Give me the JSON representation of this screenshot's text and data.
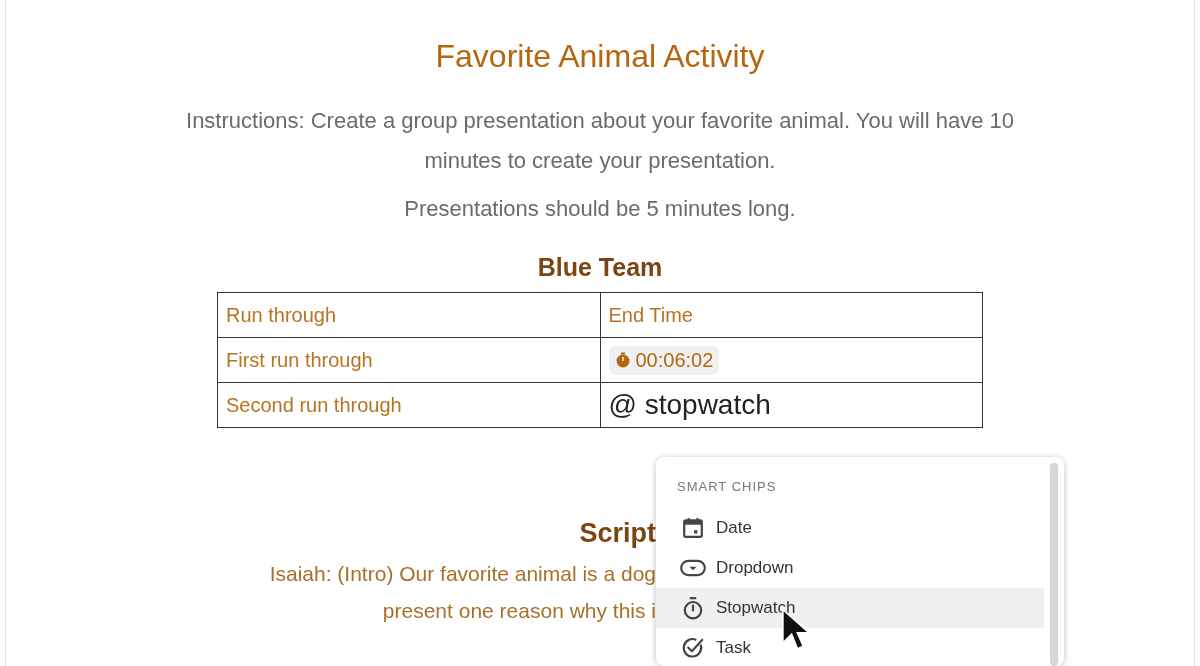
{
  "document": {
    "title": "Favorite Animal Activity",
    "instructions": [
      "Instructions: Create a group presentation about your favorite animal. You will have 10 minutes to create your presentation.",
      "Presentations should be 5 minutes long."
    ],
    "team_heading": "Blue Team",
    "table": {
      "columns": [
        "Run through",
        "End Time"
      ],
      "rows": [
        {
          "label": "First run through",
          "stopwatch": "00:06:02"
        },
        {
          "label": "Second run through",
          "typed": "@ stopwatch"
        }
      ]
    },
    "script_heading": "Script",
    "script_lines": [
      "Isaiah: (Intro) Our favorite animal is a dog",
      "present one reason why this i"
    ]
  },
  "smart_chips_menu": {
    "heading": "SMART CHIPS",
    "items": [
      {
        "label": "Date",
        "selected": false
      },
      {
        "label": "Dropdown",
        "selected": false
      },
      {
        "label": "Stopwatch",
        "selected": true
      },
      {
        "label": "Task",
        "selected": false
      }
    ]
  }
}
